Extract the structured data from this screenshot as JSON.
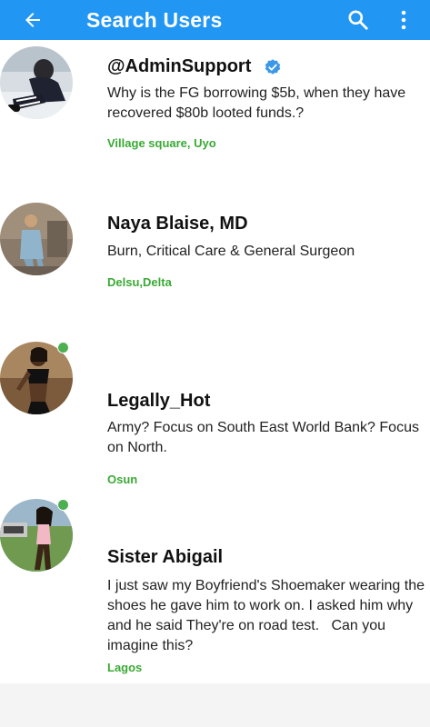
{
  "appbar": {
    "title": "Search Users",
    "color": "#2196F3",
    "back_icon": "arrow-left-icon",
    "search_icon": "search-icon",
    "more_icon": "more-vertical-icon"
  },
  "users": [
    {
      "name": "@AdminSupport",
      "verified": true,
      "online": false,
      "bio": "Why is the FG borrowing $5b, when they have recovered $80b looted funds.?",
      "location": "Village square, Uyo"
    },
    {
      "name": "Naya Blaise, MD",
      "verified": false,
      "online": false,
      "bio": "Burn, Critical Care & General Surgeon",
      "location": "Delsu,Delta"
    },
    {
      "name": "Legally_Hot",
      "verified": false,
      "online": true,
      "bio": "Army? Focus on South East World Bank? Focus on North.",
      "location": "Osun"
    },
    {
      "name": "Sister Abigail",
      "verified": false,
      "online": true,
      "bio": "I just saw my Boyfriend's Shoemaker wearing the shoes he gave him to work on. I asked him why and he said They're on road test.   Can you imagine this?",
      "location": "Lagos"
    }
  ]
}
